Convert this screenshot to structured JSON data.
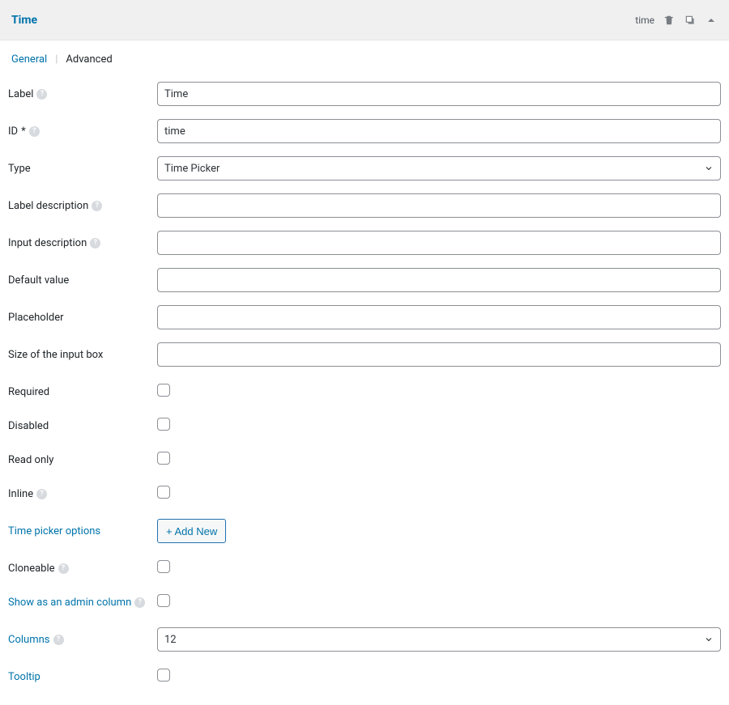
{
  "header": {
    "title": "Time",
    "slug": "time"
  },
  "tabs": {
    "general": "General",
    "advanced": "Advanced",
    "separator": "|"
  },
  "fields": {
    "label": {
      "name": "Label",
      "value": "Time"
    },
    "id": {
      "name": "ID",
      "required": "*",
      "value": "time"
    },
    "type": {
      "name": "Type",
      "value": "Time Picker"
    },
    "label_desc": {
      "name": "Label description",
      "value": ""
    },
    "input_desc": {
      "name": "Input description",
      "value": ""
    },
    "default_value": {
      "name": "Default value",
      "value": ""
    },
    "placeholder": {
      "name": "Placeholder",
      "value": ""
    },
    "input_size": {
      "name": "Size of the input box",
      "value": ""
    },
    "required": {
      "name": "Required"
    },
    "disabled": {
      "name": "Disabled"
    },
    "readonly": {
      "name": "Read only"
    },
    "inline": {
      "name": "Inline"
    },
    "time_picker_options": {
      "name": "Time picker options",
      "button": "+ Add New"
    },
    "cloneable": {
      "name": "Cloneable"
    },
    "admin_column": {
      "name": "Show as an admin column"
    },
    "columns": {
      "name": "Columns",
      "value": "12"
    },
    "tooltip": {
      "name": "Tooltip"
    }
  },
  "help_glyph": "?"
}
